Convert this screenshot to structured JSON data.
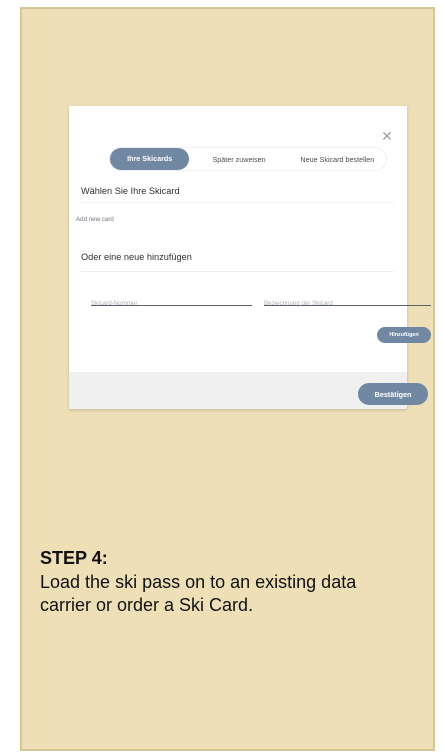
{
  "modal": {
    "close_icon": "close-icon",
    "tabs": [
      {
        "label": "Ihre Skicards",
        "active": true
      },
      {
        "label": "Später zuweisen",
        "active": false
      },
      {
        "label": "Neue Skicard bestellen",
        "active": false
      }
    ],
    "select_heading": "Wählen Sie Ihre Skicard",
    "add_new_card": "Add new card",
    "add_heading": "Oder eine neue hinzufügen",
    "card_number_placeholder": "Skicard-Nummer",
    "card_name_placeholder": "Bezeichnung der Skicard",
    "add_button": "Hinzufügen",
    "confirm_button": "Bestätigen"
  },
  "step": {
    "title": "STEP 4:",
    "text": "Load the ski pass on to an existing data carrier or order a Ski Card."
  },
  "colors": {
    "panel_bg": "#eedfb6",
    "accent": "#7088a2"
  }
}
